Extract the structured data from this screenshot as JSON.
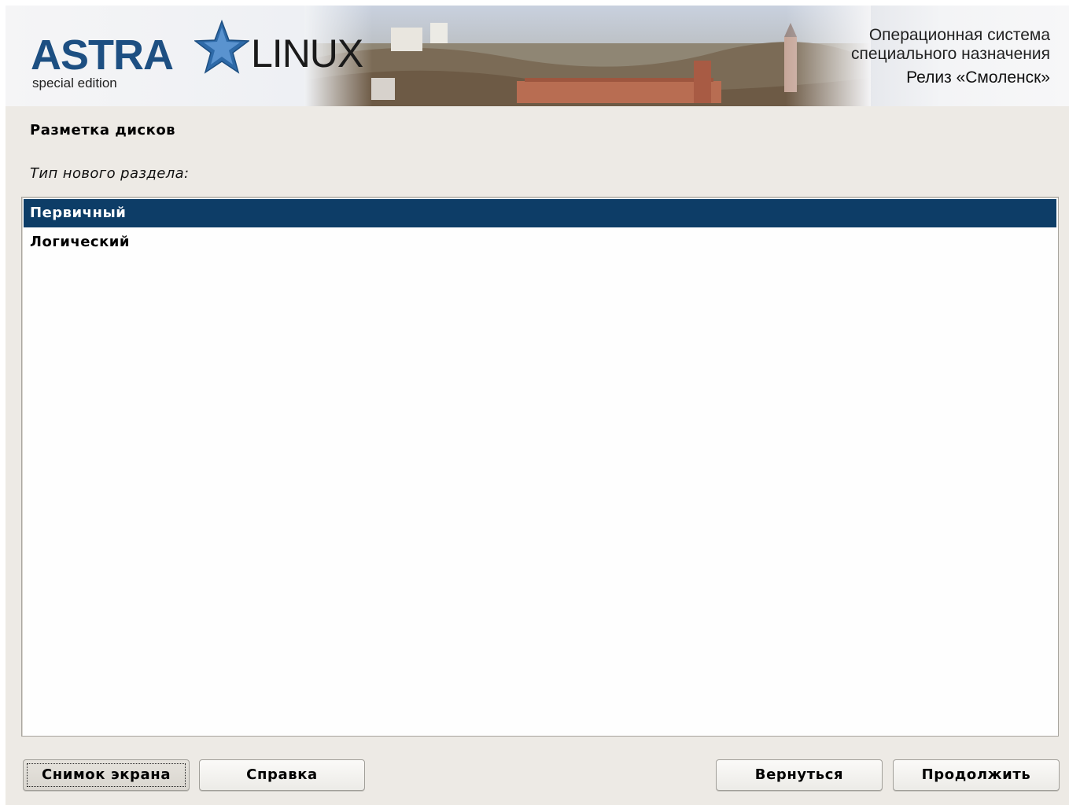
{
  "banner": {
    "logo_word": "ASTRA",
    "logo_linux": "LINUX",
    "logo_edition": "special edition",
    "os_line1": "Операционная система",
    "os_line2": "специального назначения",
    "release": "Релиз «Смоленск»"
  },
  "page": {
    "heading": "Разметка дисков",
    "prompt": "Тип нового раздела:"
  },
  "partition_types": {
    "items": [
      {
        "label": "Первичный",
        "selected": true
      },
      {
        "label": "Логический",
        "selected": false
      }
    ]
  },
  "buttons": {
    "screenshot": "Снимок экрана",
    "help": "Справка",
    "back": "Вернуться",
    "continue": "Продолжить"
  },
  "colors": {
    "brand_blue": "#1d4f82",
    "selection": "#0d3d67",
    "background": "#edeae5"
  },
  "icons": [
    "star-logo-icon"
  ]
}
